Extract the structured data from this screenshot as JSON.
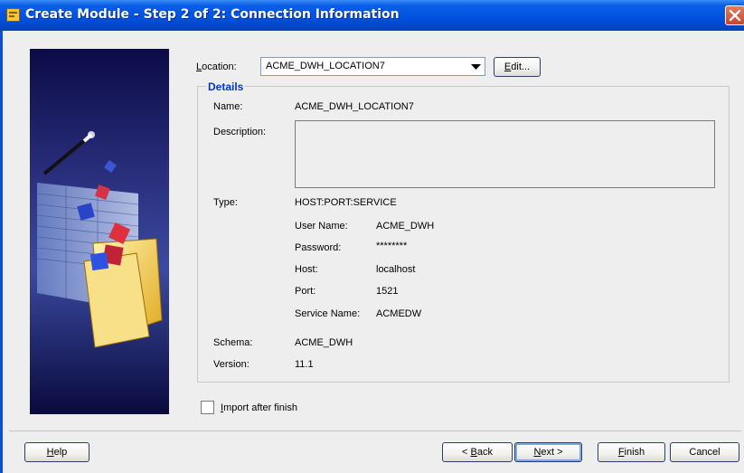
{
  "window": {
    "title": "Create Module - Step 2 of 2: Connection Information"
  },
  "location": {
    "label_prefix": "",
    "label_mnemonic": "L",
    "label_rest": "ocation:",
    "value": "ACME_DWH_LOCATION7",
    "edit_mnemonic": "E",
    "edit_rest": "dit..."
  },
  "details": {
    "legend": "Details",
    "name_label": "Name:",
    "name_value": "ACME_DWH_LOCATION7",
    "description_label": "Description:",
    "description_value": "",
    "type_label": "Type:",
    "type_value": "HOST:PORT:SERVICE",
    "user_name_label": "User Name:",
    "user_name_value": "ACME_DWH",
    "password_label": "Password:",
    "password_value": "********",
    "host_label": "Host:",
    "host_value": "localhost",
    "port_label": "Port:",
    "port_value": "1521",
    "service_name_label": "Service Name:",
    "service_name_value": "ACMEDW",
    "schema_label": "Schema:",
    "schema_value": "ACME_DWH",
    "version_label": "Version:",
    "version_value": "11.1"
  },
  "import_after_finish": {
    "mnemonic": "I",
    "rest": "mport after finish",
    "checked": false
  },
  "buttons": {
    "help_mnemonic": "H",
    "help_rest": "elp",
    "back_prefix": "< ",
    "back_mnemonic": "B",
    "back_rest": "ack",
    "next_mnemonic": "N",
    "next_rest": "ext >",
    "finish_mnemonic": "F",
    "finish_rest": "inish",
    "cancel": "Cancel"
  },
  "icons": {
    "title_icon": "module-icon",
    "close_icon": "close-icon",
    "combo_arrow": "chevron-down-icon",
    "wizard_art": "wizard-illustration"
  },
  "colors": {
    "title_bar": "#0052e0",
    "details_legend": "#0038c8",
    "close_button": "#c8452a"
  }
}
